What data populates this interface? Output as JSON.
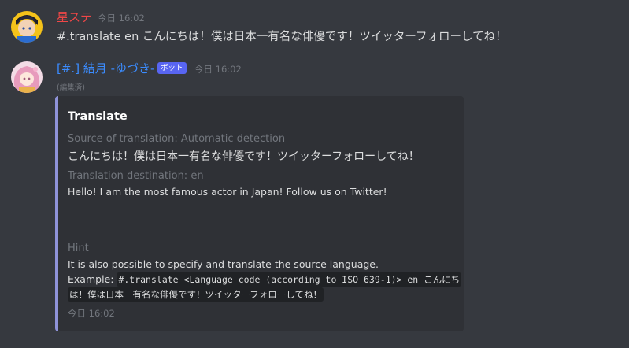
{
  "messages": [
    {
      "username": "星ステ",
      "username_color": "#f04747",
      "timestamp": "今日 16:02",
      "content": "#.translate en こんにちは！僕は日本一有名な俳優です！ツイッターフォローしてね！"
    },
    {
      "username": "[#.] 結月 -ゆづき-",
      "username_color": "#3b8cff",
      "badge": "ボット",
      "timestamp": "今日 16:02",
      "edited": "(編集済)",
      "embed": {
        "accent_color": "#8f93d9",
        "title": "Translate",
        "fields": [
          {
            "name": "Source of translation: Automatic detection",
            "value": "こんにちは！僕は日本一有名な俳優です！ツイッターフォローしてね！"
          },
          {
            "name": "Translation destination: en",
            "value": "Hello! I am the most famous actor in Japan! Follow us on Twitter!"
          },
          {
            "name": "Hint",
            "value_line1": "It is also possible to specify and translate the source language.",
            "example_label": "Example:",
            "example_code": "#.translate <Language code (according to ISO 639-1)> en こんにち",
            "example_code_2": "は！僕は日本一有名な俳優です！ツイッターフォローしてね！"
          }
        ],
        "footer": "今日 16:02"
      }
    }
  ]
}
